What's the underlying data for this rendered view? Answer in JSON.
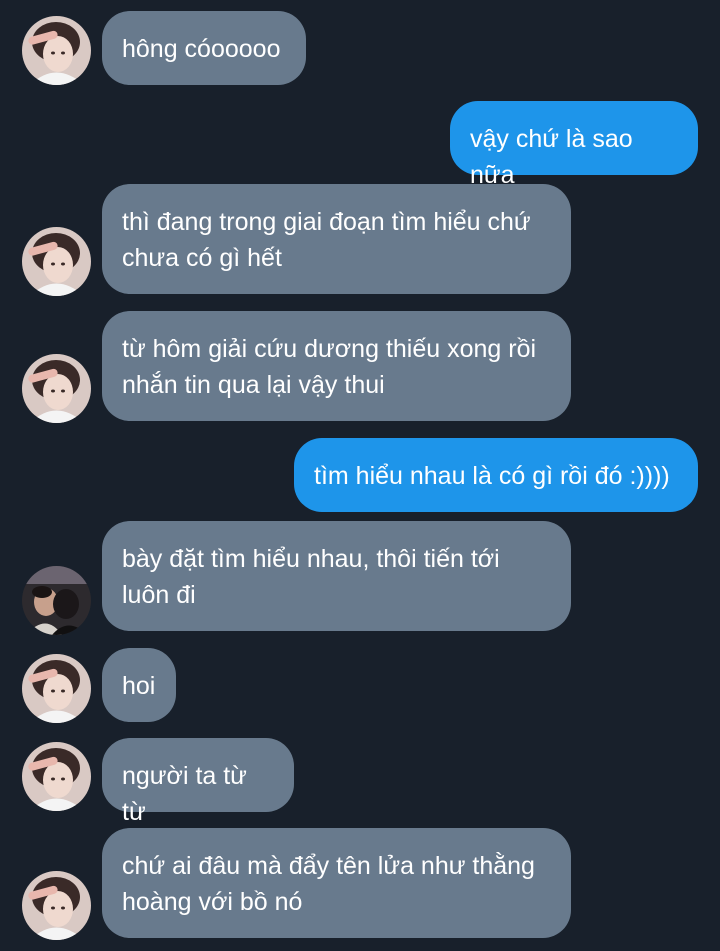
{
  "conversation": {
    "messages": [
      {
        "side": "in",
        "avatar": "girl-avatar-icon",
        "text": "hông cóooooo"
      },
      {
        "side": "out",
        "avatar": "",
        "text": "vậy chứ là sao nữa"
      },
      {
        "side": "in",
        "avatar": "girl-avatar-icon",
        "text": "thì đang trong giai đoạn tìm hiểu chứ chưa có gì hết"
      },
      {
        "side": "in",
        "avatar": "girl-avatar-icon",
        "text": "từ hôm giải cứu dương thiếu xong rồi nhắn tin qua lại vậy thui"
      },
      {
        "side": "out",
        "avatar": "",
        "text": "tìm hiểu nhau là có gì rồi đó :))))"
      },
      {
        "side": "in",
        "avatar": "couple-avatar-icon",
        "text": "bày đặt tìm hiểu nhau, thôi tiến tới luôn đi"
      },
      {
        "side": "in",
        "avatar": "girl-avatar-icon",
        "text": "hoi"
      },
      {
        "side": "in",
        "avatar": "girl-avatar-icon",
        "text": "người ta từ từ"
      },
      {
        "side": "in",
        "avatar": "girl-avatar-icon",
        "text": "chứ ai đâu mà đẩy tên lửa như thằng hoàng với bồ nó"
      }
    ]
  },
  "colors": {
    "background": "#18202b",
    "incoming_bubble": "#687a8d",
    "outgoing_bubble": "#1e95ea",
    "text": "#ffffff"
  }
}
